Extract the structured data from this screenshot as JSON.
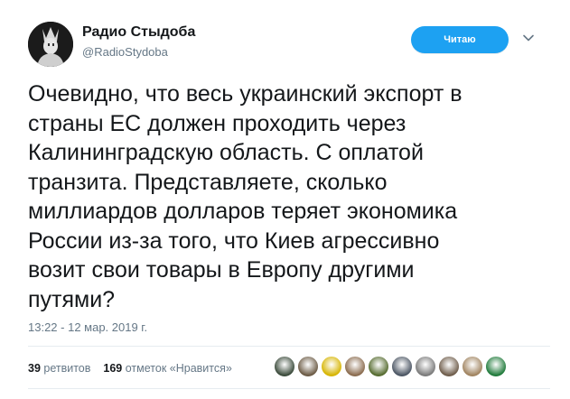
{
  "author": {
    "name": "Радио Стыдоба",
    "handle": "@RadioStydoba"
  },
  "follow_button": {
    "label": "Читаю"
  },
  "tweet": {
    "lines": [
      "Очевидно, что весь украинский экспорт в",
      "страны ЕС должен проходить через",
      "Калининградскую область. С оплатой",
      "транзита. Представляете, сколько",
      "миллиардов долларов теряет экономика",
      "России из-за того, что Киев агрессивно",
      "возит свои товары в Европу другими",
      "путями?"
    ],
    "timestamp": "13:22 - 12 мар. 2019 г."
  },
  "stats": {
    "retweets_count": "39",
    "retweets_label": "ретвитов",
    "likes_count": "169",
    "likes_label": "отметок «Нравится»"
  },
  "likers": [
    {
      "color": "#3a4a3a"
    },
    {
      "color": "#6b5a44"
    },
    {
      "color": "#d6b400"
    },
    {
      "color": "#8a6b4e"
    },
    {
      "color": "#556b2f"
    },
    {
      "color": "#4b5563"
    },
    {
      "color": "#7a7a7a"
    },
    {
      "color": "#6e5c4a"
    },
    {
      "color": "#a0835f"
    },
    {
      "color": "#1f7a3a"
    }
  ],
  "colors": {
    "accent": "#1da1f2",
    "text": "#14171a",
    "secondary": "#657786"
  }
}
